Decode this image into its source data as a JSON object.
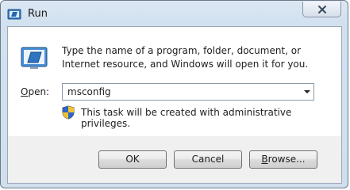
{
  "window": {
    "title": "Run",
    "title_icon": "run-icon",
    "close_icon": "close-icon"
  },
  "dialog": {
    "app_icon": "run-program-icon",
    "description": "Type the name of a program, folder, document, or Internet resource, and Windows will open it for you.",
    "open_label_accel": "O",
    "open_label_rest": "pen:",
    "combo_value": "msconfig",
    "shield_icon": "uac-shield-icon",
    "admin_note": "This task will be created with administrative privileges."
  },
  "buttons": {
    "ok": "OK",
    "cancel": "Cancel",
    "browse_accel": "B",
    "browse_rest": "rowse..."
  },
  "colors": {
    "frame": "#cfdfee",
    "client": "#ffffff",
    "footer": "#f0f0f0"
  }
}
